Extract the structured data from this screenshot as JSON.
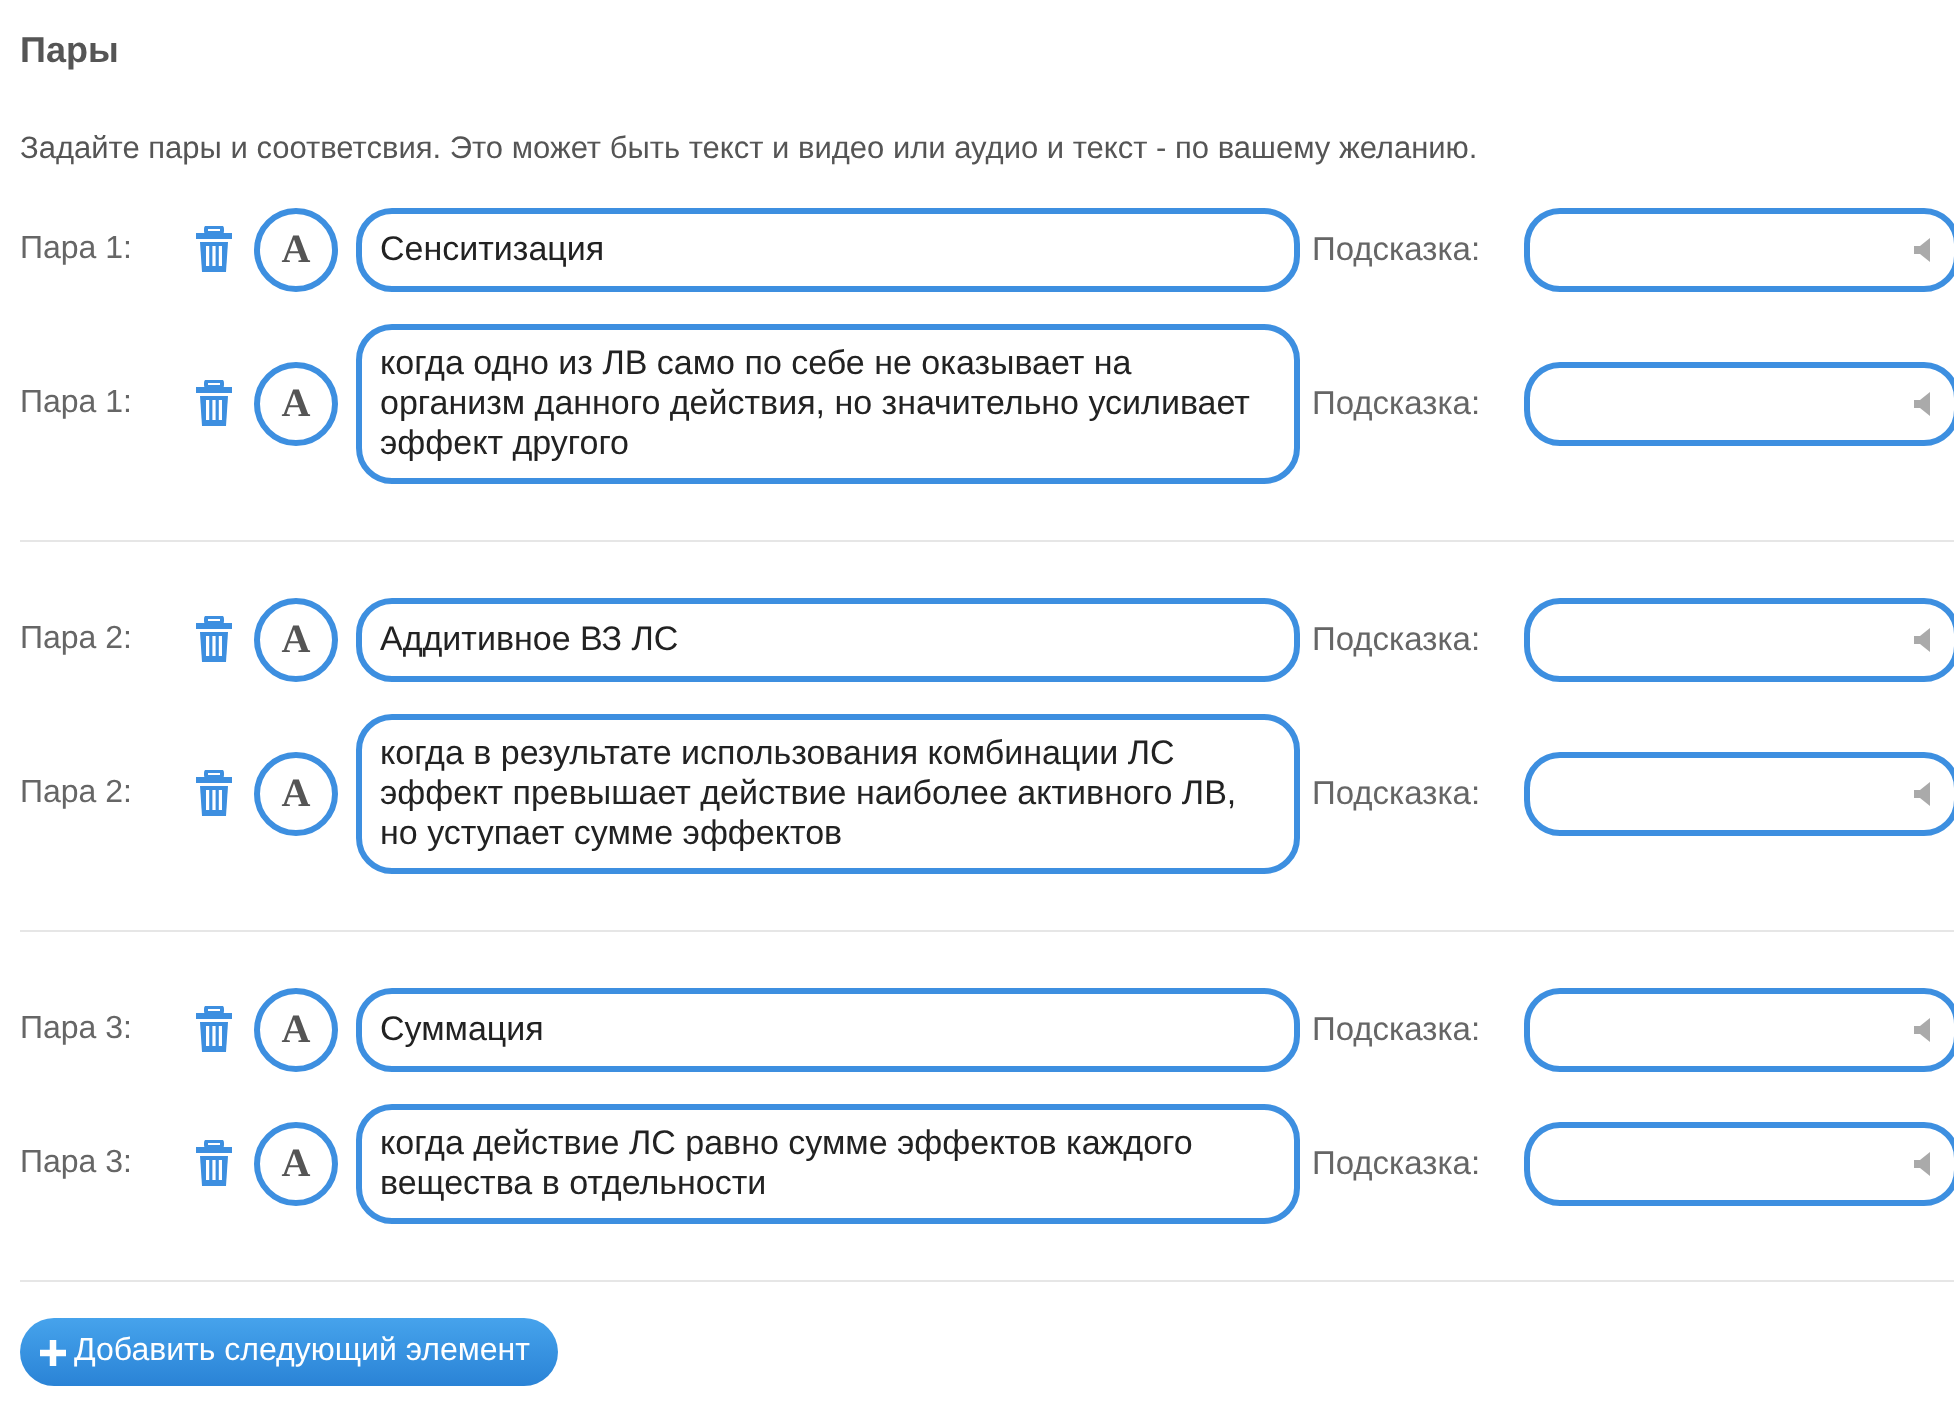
{
  "section_title": "Пары",
  "description": "Задайте пары и соответсвия. Это может быть текст и видео или аудио и текст - по вашему желанию.",
  "pairs": [
    {
      "rows": [
        {
          "label": "Пара 1:",
          "format_glyph": "A",
          "text": "Сенситизация",
          "hint_label": "Подсказка:"
        },
        {
          "label": "Пара 1:",
          "format_glyph": "A",
          "text": "когда одно из ЛВ само по себе не оказывает на организм данного действия, но значительно усиливает эффект другого",
          "hint_label": "Подсказка:"
        }
      ]
    },
    {
      "rows": [
        {
          "label": "Пара 2:",
          "format_glyph": "A",
          "text": "Аддитивное ВЗ ЛС",
          "hint_label": "Подсказка:"
        },
        {
          "label": "Пара 2:",
          "format_glyph": "A",
          "text": "когда в результате использования комбинации ЛС эффект превышает действие наиболее активного ЛВ, но уступает сумме эффектов",
          "hint_label": "Подсказка:"
        }
      ]
    },
    {
      "rows": [
        {
          "label": "Пара 3:",
          "format_glyph": "A",
          "text": "Суммация",
          "hint_label": "Подсказка:"
        },
        {
          "label": "Пара 3:",
          "format_glyph": "A",
          "text": "когда действие ЛС равно сумме эффектов каждого вещества в отдельности",
          "hint_label": "Подсказка:"
        }
      ]
    }
  ],
  "add_button": "Добавить следующий элемент"
}
